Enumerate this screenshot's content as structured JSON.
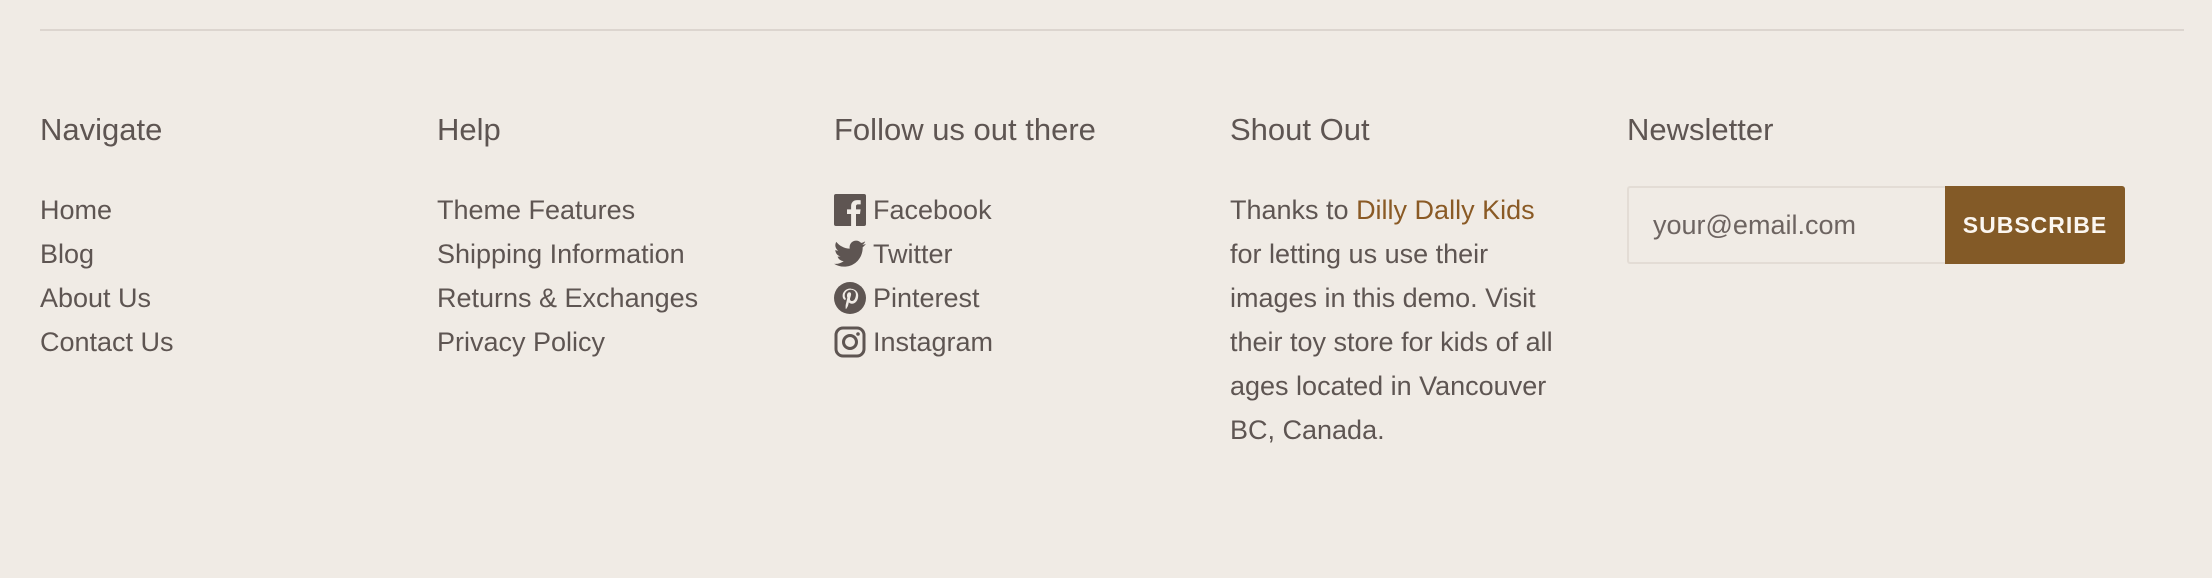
{
  "footer": {
    "navigate": {
      "heading": "Navigate",
      "links": [
        "Home",
        "Blog",
        "About Us",
        "Contact Us"
      ]
    },
    "help": {
      "heading": "Help",
      "links": [
        "Theme Features",
        "Shipping Information",
        "Returns & Exchanges",
        "Privacy Policy"
      ]
    },
    "social": {
      "heading": "Follow us out there",
      "links": [
        {
          "label": "Facebook",
          "icon": "facebook-icon"
        },
        {
          "label": "Twitter",
          "icon": "twitter-icon"
        },
        {
          "label": "Pinterest",
          "icon": "pinterest-icon"
        },
        {
          "label": "Instagram",
          "icon": "instagram-icon"
        }
      ]
    },
    "shoutout": {
      "heading": "Shout Out",
      "text_before": "Thanks to ",
      "link_text": "Dilly Dally Kids",
      "text_after": " for letting us use their images in this demo. Visit their toy store for kids of all ages located in Vancouver BC, Canada."
    },
    "newsletter": {
      "heading": "Newsletter",
      "email_placeholder": "your@email.com",
      "email_value": "",
      "subscribe_label": "SUBSCRIBE"
    }
  },
  "colors": {
    "background": "#f0ebe5",
    "text": "#5e5552",
    "accent": "#835a27",
    "link_accent": "#8a5a25"
  }
}
